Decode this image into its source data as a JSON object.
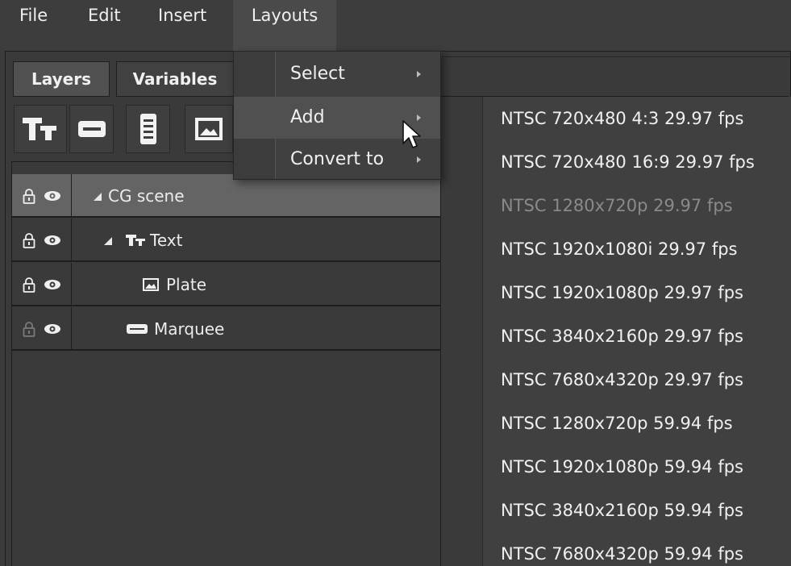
{
  "menubar": {
    "items": [
      {
        "label": "File"
      },
      {
        "label": "Edit"
      },
      {
        "label": "Insert"
      },
      {
        "label": "Layouts"
      }
    ]
  },
  "tabs": [
    {
      "label": "Layers",
      "active": true
    },
    {
      "label": "Variables",
      "active": false
    }
  ],
  "toolbar": {
    "buttons": [
      {
        "icon": "text-tool-icon"
      },
      {
        "icon": "marquee-tool-icon"
      },
      {
        "icon": "roll-tool-icon"
      },
      {
        "icon": "image-plate-icon"
      }
    ]
  },
  "layers": [
    {
      "label": "CG scene",
      "icon": "triangle-expand-icon",
      "selected": true,
      "locked_dim": false
    },
    {
      "label": "Text",
      "icon": "text-icon",
      "selected": false,
      "locked_dim": false
    },
    {
      "label": "Plate",
      "icon": "image-icon",
      "selected": false,
      "locked_dim": false
    },
    {
      "label": "Marquee",
      "icon": "marquee-icon",
      "selected": false,
      "locked_dim": true
    }
  ],
  "layouts_menu": {
    "items": [
      {
        "label": "Select"
      },
      {
        "label": "Add"
      },
      {
        "label": "Convert to"
      }
    ]
  },
  "add_submenu": {
    "items": [
      {
        "label": "NTSC 720x480 4:3 29.97 fps",
        "enabled": true
      },
      {
        "label": "NTSC 720x480 16:9 29.97 fps",
        "enabled": true
      },
      {
        "label": "NTSC 1280x720p 29.97 fps",
        "enabled": false
      },
      {
        "label": "NTSC 1920x1080i 29.97 fps",
        "enabled": true
      },
      {
        "label": "NTSC 1920x1080p 29.97 fps",
        "enabled": true
      },
      {
        "label": "NTSC 3840x2160p 29.97 fps",
        "enabled": true
      },
      {
        "label": "NTSC 7680x4320p 29.97 fps",
        "enabled": true
      },
      {
        "label": "NTSC 1280x720p 59.94 fps",
        "enabled": true
      },
      {
        "label": "NTSC 1920x1080p 59.94 fps",
        "enabled": true
      },
      {
        "label": "NTSC 3840x2160p 59.94 fps",
        "enabled": true
      },
      {
        "label": "NTSC 7680x4320p 59.94 fps",
        "enabled": true
      }
    ]
  },
  "colors": {
    "background": "#3b3b3b",
    "selected_row": "#646464",
    "menu_bg": "#404040",
    "disabled_text": "#8a8a8a"
  }
}
